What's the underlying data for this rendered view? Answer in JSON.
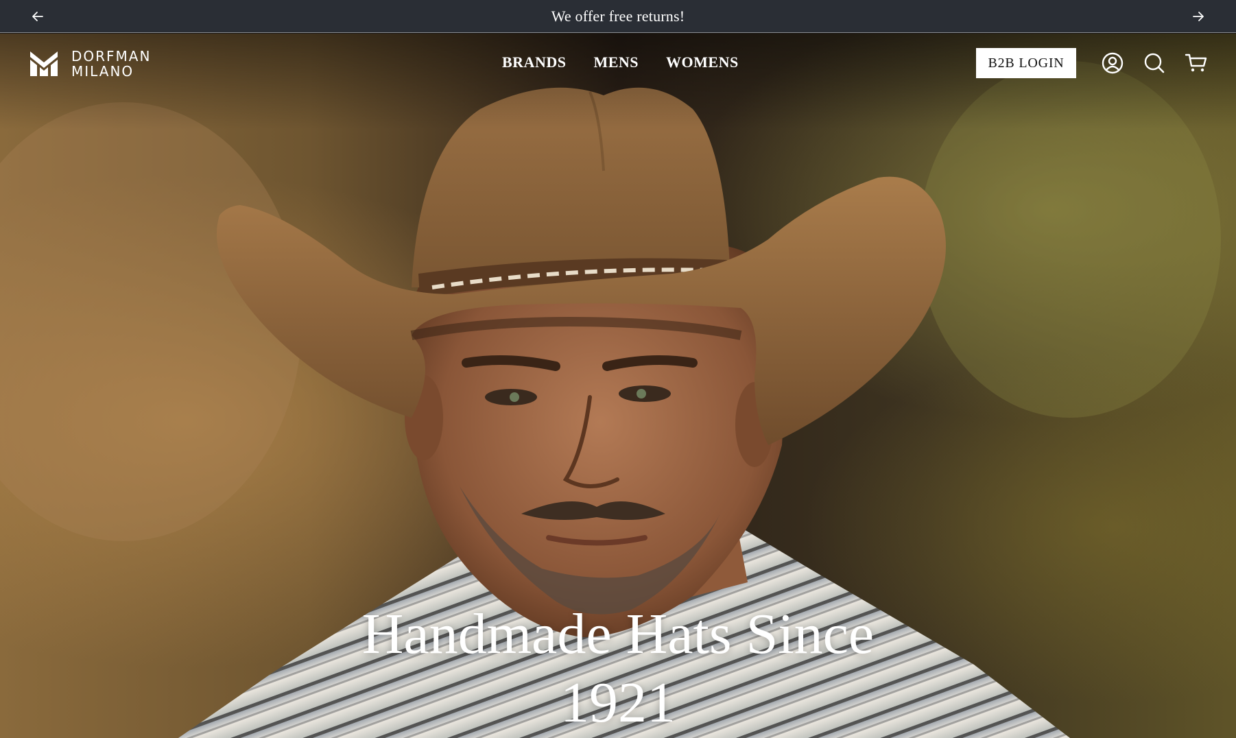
{
  "announcement": {
    "text": "We offer free returns!",
    "prev_icon": "arrow-left-icon",
    "next_icon": "arrow-right-icon"
  },
  "brand": {
    "line1": "DORFMAN",
    "line2": "MILANO",
    "logo_icon": "dm-monogram-icon"
  },
  "nav": {
    "items": [
      {
        "label": "BRANDS"
      },
      {
        "label": "MENS"
      },
      {
        "label": "WOMENS"
      }
    ]
  },
  "header": {
    "b2b_label": "B2B LOGIN",
    "icons": [
      "account-icon",
      "search-icon",
      "cart-icon"
    ]
  },
  "hero": {
    "headline_line1": "Handmade Hats Since",
    "headline_line2": "1921",
    "image_subject": "man-in-cowboy-hat-photo"
  },
  "colors": {
    "announcement_bg": "#2a2e35",
    "button_bg": "#ffffff",
    "text": "#ffffff"
  }
}
